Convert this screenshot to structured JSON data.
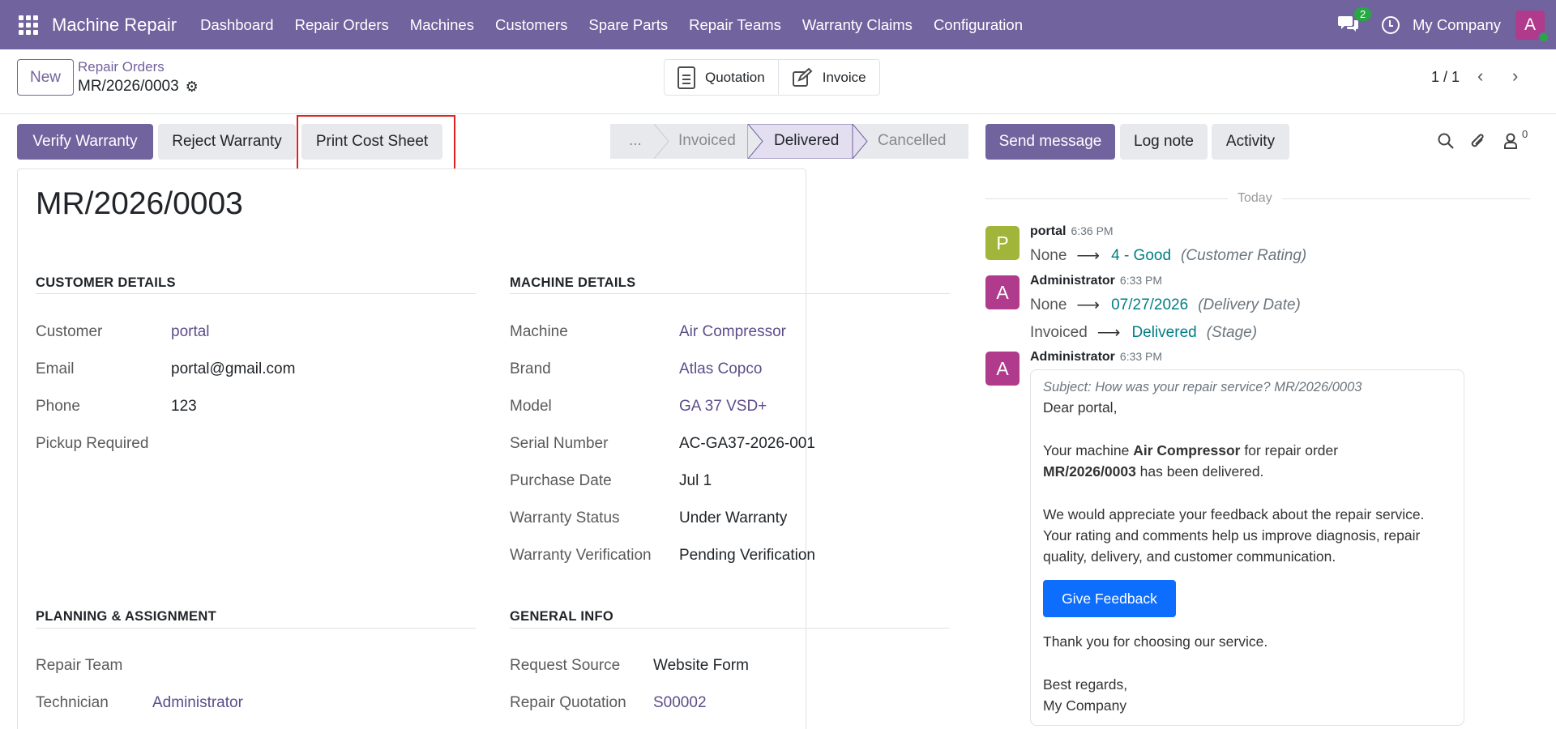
{
  "navbar": {
    "brand": "Machine Repair",
    "menu": [
      "Dashboard",
      "Repair Orders",
      "Machines",
      "Customers",
      "Spare Parts",
      "Repair Teams",
      "Warranty Claims",
      "Configuration"
    ],
    "messages_count": "2",
    "company": "My Company",
    "user_initial": "A",
    "colors": {
      "navbar_bg": "#71639e",
      "online_dot": "#28a745"
    }
  },
  "control": {
    "new_label": "New",
    "breadcrumb_parent": "Repair Orders",
    "breadcrumb_current": "MR/2026/0003",
    "smart_buttons": {
      "quotation": "Quotation",
      "invoice": "Invoice"
    },
    "pager": "1 / 1"
  },
  "actions": {
    "verify_warranty": "Verify Warranty",
    "reject_warranty": "Reject Warranty",
    "print_cost_sheet": "Print Cost Sheet"
  },
  "statusbar": {
    "stages": [
      "...",
      "Invoiced",
      "Delivered",
      "Cancelled"
    ],
    "active": "Delivered"
  },
  "form": {
    "title": "MR/2026/0003",
    "customer_details": {
      "heading": "CUSTOMER DETAILS",
      "customer_label": "Customer",
      "customer_value": "portal",
      "email_label": "Email",
      "email_value": "portal@gmail.com",
      "phone_label": "Phone",
      "phone_value": "123",
      "pickup_label": "Pickup Required"
    },
    "machine_details": {
      "heading": "MACHINE DETAILS",
      "machine_label": "Machine",
      "machine_value": "Air Compressor",
      "brand_label": "Brand",
      "brand_value": "Atlas Copco",
      "model_label": "Model",
      "model_value": "GA 37 VSD+",
      "serial_label": "Serial Number",
      "serial_value": "AC-GA37-2026-001",
      "purchase_label": "Purchase Date",
      "purchase_value": "Jul 1",
      "warranty_status_label": "Warranty Status",
      "warranty_status_value": "Under Warranty",
      "warranty_verif_label": "Warranty Verification",
      "warranty_verif_value": "Pending Verification"
    },
    "planning": {
      "heading": "PLANNING & ASSIGNMENT",
      "team_label": "Repair Team",
      "tech_label": "Technician",
      "tech_value": "Administrator"
    },
    "general": {
      "heading": "GENERAL INFO",
      "source_label": "Request Source",
      "source_value": "Website Form",
      "quote_label": "Repair Quotation",
      "quote_value": "S00002"
    }
  },
  "chatter": {
    "send_message": "Send message",
    "log_note": "Log note",
    "activity": "Activity",
    "followers_count": "0",
    "day": "Today",
    "messages": [
      {
        "initial": "P",
        "author": "portal",
        "time": "6:36 PM",
        "avatar_color": "#a2b53b",
        "old": "None",
        "new": "4 - Good",
        "field": "(Customer Rating)"
      },
      {
        "initial": "A",
        "author": "Administrator",
        "time": "6:33 PM",
        "avatar_color": "#b03a8b",
        "old": "None",
        "new": "07/27/2026",
        "field": "(Delivery Date)",
        "old2": "Invoiced",
        "new2": "Delivered",
        "field2": "(Stage)"
      },
      {
        "initial": "A",
        "author": "Administrator",
        "time": "6:33 PM",
        "avatar_color": "#b03a8b",
        "subject": "Subject: How was your repair service? MR/2026/0003",
        "greeting": "Dear portal,",
        "p1_a": "Your machine ",
        "p1_machine": "Air Compressor",
        "p1_b": " for repair order",
        "p1_order": "MR/2026/0003",
        "p1_c": " has been delivered.",
        "p2_l1": "We would appreciate your feedback about the repair service.",
        "p2_l2": "Your rating and comments help us improve diagnosis, repair",
        "p2_l3": "quality, delivery, and customer communication.",
        "button": "Give Feedback",
        "thanks": "Thank you for choosing our service.",
        "regards": "Best regards,",
        "signature": "My Company"
      }
    ]
  }
}
